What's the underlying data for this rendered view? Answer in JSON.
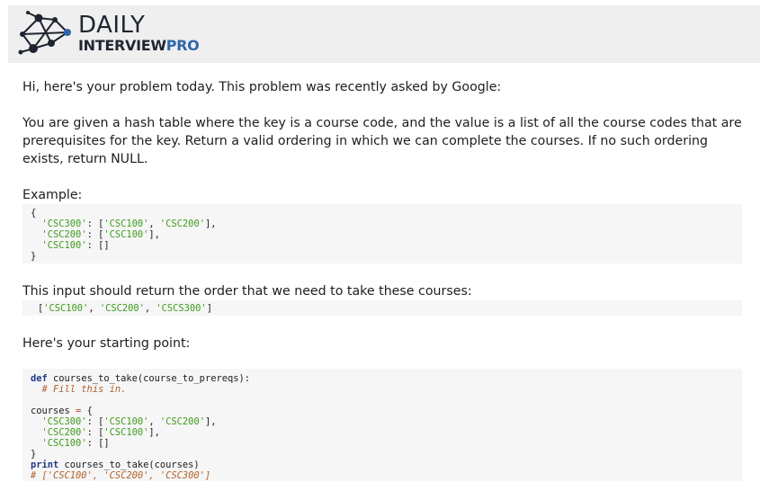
{
  "logo": {
    "line1": "DAILY",
    "line2_a": "INTERVIEW",
    "line2_b": "PRO",
    "icon": "network-nodes-icon",
    "colors": {
      "dark": "#1f2530",
      "blue": "#2f66a9"
    }
  },
  "intro": "Hi, here's your problem today. This problem was recently asked by Google:",
  "description": "You are given a hash table where the key is a course code, and the value is a list of all the course codes that are prerequisites for the key. Return a valid ordering in which we can complete the courses. If no such ordering exists, return NULL.",
  "example_label": "Example:",
  "example_code": {
    "open": "{",
    "close": "}",
    "rows": [
      {
        "key": "'CSC300'",
        "sep": ": [",
        "items": [
          "'CSC100'",
          "'CSC200'"
        ],
        "end": "],"
      },
      {
        "key": "'CSC200'",
        "sep": ": [",
        "items": [
          "'CSC100'"
        ],
        "end": "],"
      },
      {
        "key": "'CSC100'",
        "sep": ": []",
        "items": [],
        "end": ""
      }
    ]
  },
  "order_label": "This input should return the order that we need to take these courses:",
  "order_code": {
    "open": "[",
    "items": [
      "'CSC100'",
      "'CSC200'",
      "'CSCS300'"
    ],
    "close": "]"
  },
  "start_label": "Here's your starting point:",
  "starter": {
    "def_kw": "def",
    "signature": " courses_to_take(course_to_prereqs):",
    "fill_comment": "# Fill this in.",
    "courses_var": "courses ",
    "eq": "=",
    "brace_open": " {",
    "brace_close": "}",
    "print_kw": "print",
    "print_call": " courses_to_take(courses)",
    "result_comment": "# ['CSC100', 'CSC200', 'CSC300']"
  },
  "colors": {
    "string": "#3f9b1e",
    "keyword": "#1d3b86",
    "comment": "#b0622b",
    "operator": "#c0392b",
    "code_bg": "#f6f6f6",
    "header_bg": "#efefef"
  }
}
